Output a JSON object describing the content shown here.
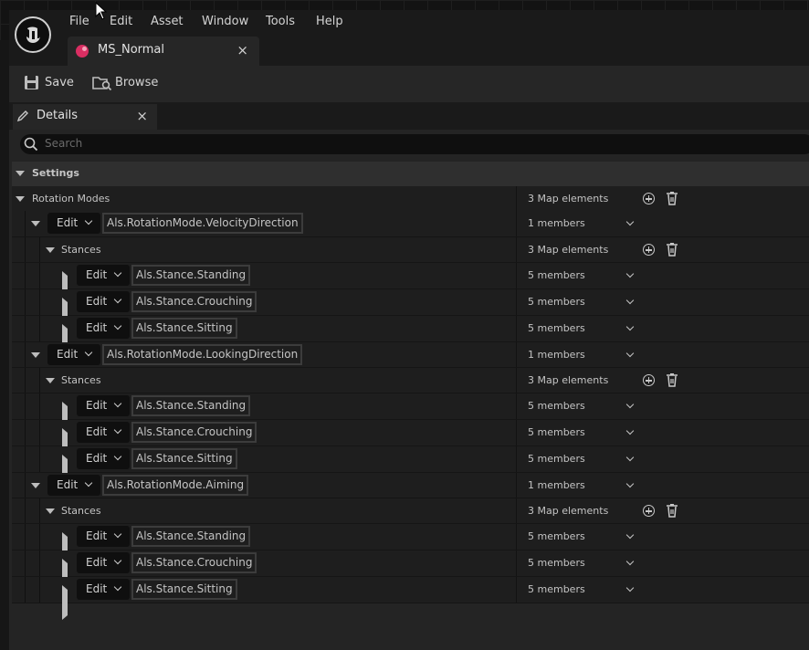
{
  "menu": [
    "File",
    "Edit",
    "Asset",
    "Window",
    "Tools",
    "Help"
  ],
  "document_tab": {
    "title": "MS_Normal",
    "close": "×"
  },
  "toolbar": {
    "save_label": "Save",
    "browse_label": "Browse"
  },
  "details_tab": {
    "title": "Details",
    "close": "×"
  },
  "search": {
    "placeholder": "Search"
  },
  "section": {
    "title": "Settings"
  },
  "property": {
    "label": "Rotation Modes",
    "value": "3 Map elements"
  },
  "rows": [
    {
      "kind": "mode",
      "edit": "Edit",
      "key": "Als.RotationMode.VelocityDirection",
      "value": "1 members"
    },
    {
      "kind": "stances",
      "label": "Stances",
      "value": "3 Map elements"
    },
    {
      "kind": "stance",
      "edit": "Edit",
      "key": "Als.Stance.Standing",
      "value": "5 members"
    },
    {
      "kind": "stance",
      "edit": "Edit",
      "key": "Als.Stance.Crouching",
      "value": "5 members"
    },
    {
      "kind": "stance",
      "edit": "Edit",
      "key": "Als.Stance.Sitting",
      "value": "5 members"
    },
    {
      "kind": "mode",
      "edit": "Edit",
      "key": "Als.RotationMode.LookingDirection",
      "value": "1 members"
    },
    {
      "kind": "stances",
      "label": "Stances",
      "value": "3 Map elements"
    },
    {
      "kind": "stance",
      "edit": "Edit",
      "key": "Als.Stance.Standing",
      "value": "5 members"
    },
    {
      "kind": "stance",
      "edit": "Edit",
      "key": "Als.Stance.Crouching",
      "value": "5 members"
    },
    {
      "kind": "stance",
      "edit": "Edit",
      "key": "Als.Stance.Sitting",
      "value": "5 members"
    },
    {
      "kind": "mode",
      "edit": "Edit",
      "key": "Als.RotationMode.Aiming",
      "value": "1 members"
    },
    {
      "kind": "stances",
      "label": "Stances",
      "value": "3 Map elements"
    },
    {
      "kind": "stance",
      "edit": "Edit",
      "key": "Als.Stance.Standing",
      "value": "5 members"
    },
    {
      "kind": "stance",
      "edit": "Edit",
      "key": "Als.Stance.Crouching",
      "value": "5 members"
    },
    {
      "kind": "stance",
      "edit": "Edit",
      "key": "Als.Stance.Sitting",
      "value": "5 members"
    }
  ],
  "colors": {
    "accent": "#d92e62",
    "background": "#242424"
  }
}
